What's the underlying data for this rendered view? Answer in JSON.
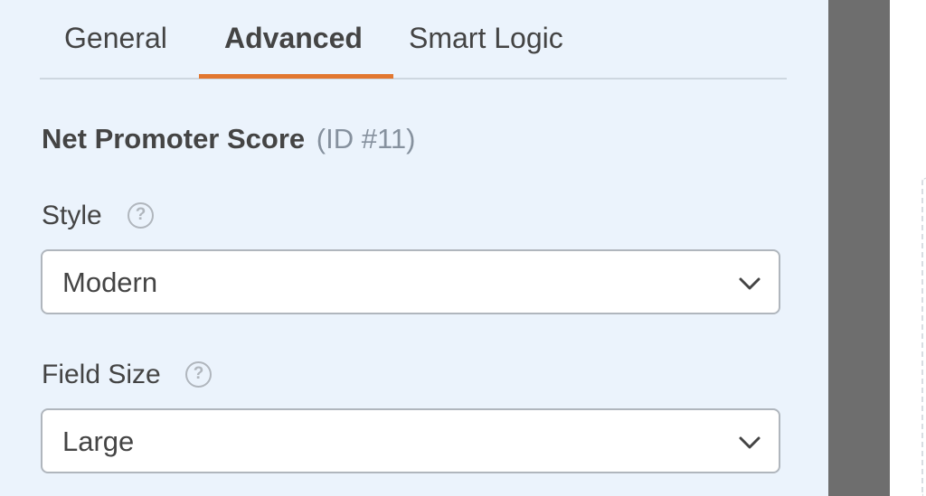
{
  "tabs": [
    {
      "label": "General",
      "active": false
    },
    {
      "label": "Advanced",
      "active": true
    },
    {
      "label": "Smart Logic",
      "active": false
    }
  ],
  "field": {
    "name": "Net Promoter Score",
    "id_label": "(ID #11)"
  },
  "style": {
    "label": "Style",
    "help_glyph": "?",
    "value": "Modern"
  },
  "field_size": {
    "label": "Field Size",
    "help_glyph": "?",
    "value": "Large"
  },
  "colors": {
    "panel_bg": "#ebf3fc",
    "accent": "#e27730",
    "text": "#444444",
    "muted": "#86919e",
    "divider": "#6e6e6e"
  },
  "icons": {
    "help": "question-circle-icon",
    "dropdown": "chevron-down-icon"
  }
}
